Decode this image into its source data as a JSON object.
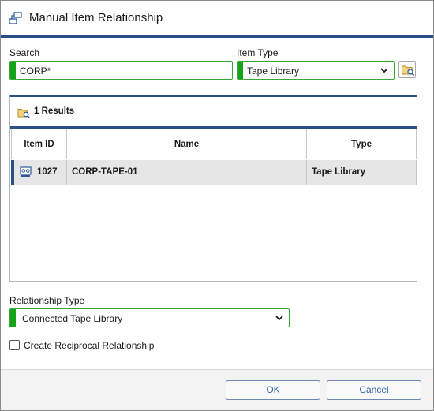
{
  "window": {
    "title": "Manual Item Relationship",
    "title_icon": "relationship-icon"
  },
  "search": {
    "label": "Search",
    "value": "CORP*"
  },
  "item_type": {
    "label": "Item Type",
    "value": "Tape Library",
    "browse_icon": "folder-search-icon"
  },
  "results": {
    "count_label": "1 Results",
    "columns": [
      "Item ID",
      "Name",
      "Type"
    ],
    "rows": [
      {
        "id": "1027",
        "name": "CORP-TAPE-01",
        "type": "Tape Library",
        "icon": "tape-library-icon"
      }
    ]
  },
  "relationship_type": {
    "label": "Relationship Type",
    "value": "Connected Tape Library"
  },
  "reciprocal": {
    "label": "Create Reciprocal Relationship",
    "checked": false
  },
  "buttons": {
    "ok": "OK",
    "cancel": "Cancel"
  },
  "colors": {
    "accent": "#2b4f86",
    "valid": "#17a317",
    "button_text": "#3565a8"
  }
}
